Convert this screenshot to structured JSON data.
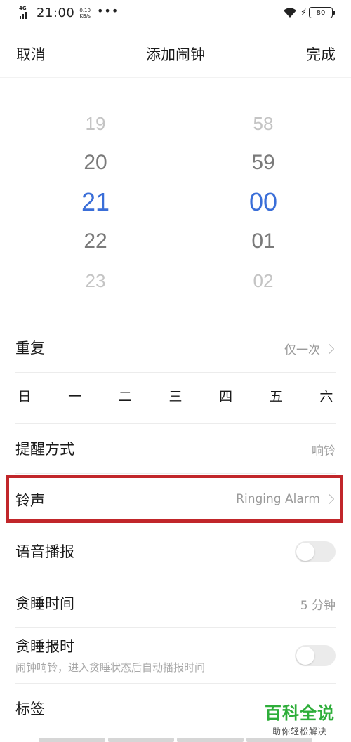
{
  "status_bar": {
    "network": "4G",
    "time": "21:00",
    "speed_value": "0.10",
    "speed_unit": "KB/s",
    "dots": "•••",
    "battery": "80",
    "charging_icon": "bolt-icon"
  },
  "nav": {
    "cancel": "取消",
    "title": "添加闹钟",
    "done": "完成"
  },
  "time_picker": {
    "hours": [
      "19",
      "20",
      "21",
      "22",
      "23"
    ],
    "minutes": [
      "58",
      "59",
      "00",
      "01",
      "02"
    ],
    "selected_hour": "21",
    "selected_minute": "00",
    "accent_color": "#3a6ed8"
  },
  "repeat": {
    "label": "重复",
    "value": "仅一次"
  },
  "weekdays": [
    "日",
    "一",
    "二",
    "三",
    "四",
    "五",
    "六"
  ],
  "reminder": {
    "label": "提醒方式",
    "value": "响铃"
  },
  "ringtone": {
    "label": "铃声",
    "value": "Ringing Alarm",
    "highlight_color": "#c1262a"
  },
  "voice": {
    "label": "语音播报",
    "enabled": false
  },
  "snooze_time": {
    "label": "贪睡时间",
    "value": "5 分钟"
  },
  "snooze_report": {
    "label": "贪睡报时",
    "description": "闹钟响铃，进入贪睡状态后自动播报时间",
    "enabled": false
  },
  "tag": {
    "label": "标签"
  },
  "watermark": {
    "main": "百科全说",
    "sub": "助你轻松解决"
  }
}
